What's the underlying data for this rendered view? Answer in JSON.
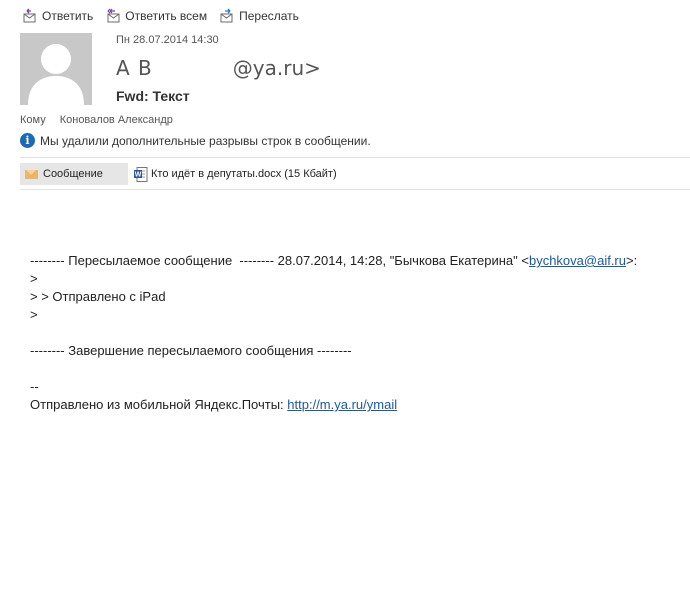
{
  "toolbar": {
    "reply_label": "Ответить",
    "reply_all_label": "Ответить всем",
    "forward_label": "Переслать"
  },
  "header": {
    "date": "Пн 28.07.2014 14:30",
    "sender_name": "А В",
    "sender_email_suffix": "@ya.ru>",
    "subject": "Fwd: Текст",
    "to_label": "Кому",
    "to_value": "Коновалов Александр"
  },
  "notice": {
    "text": "Мы удалили дополнительные разрывы строк в сообщении."
  },
  "attachments": {
    "message_tab_label": "Сообщение",
    "file_label": "Кто идёт в депутаты.docx (15 Кбайт)"
  },
  "body": {
    "fwd_header_prefix": "-------- Пересылаемое сообщение  -------- 28.07.2014, 14:28, \"Бычкова Екатерина\" <",
    "fwd_header_email": "bychkova@aif.ru",
    "fwd_header_suffix": ">:",
    "line2": ">",
    "line3": "> > Отправлено с iPad",
    "line4": ">",
    "line5": "",
    "line6": "-------- Завершение пересылаемого сообщения --------",
    "line7": "",
    "line8": "--",
    "signature_prefix": "Отправлено из мобильной Яндекс.Почты: ",
    "signature_link": "http://m.ya.ru/ymail"
  }
}
